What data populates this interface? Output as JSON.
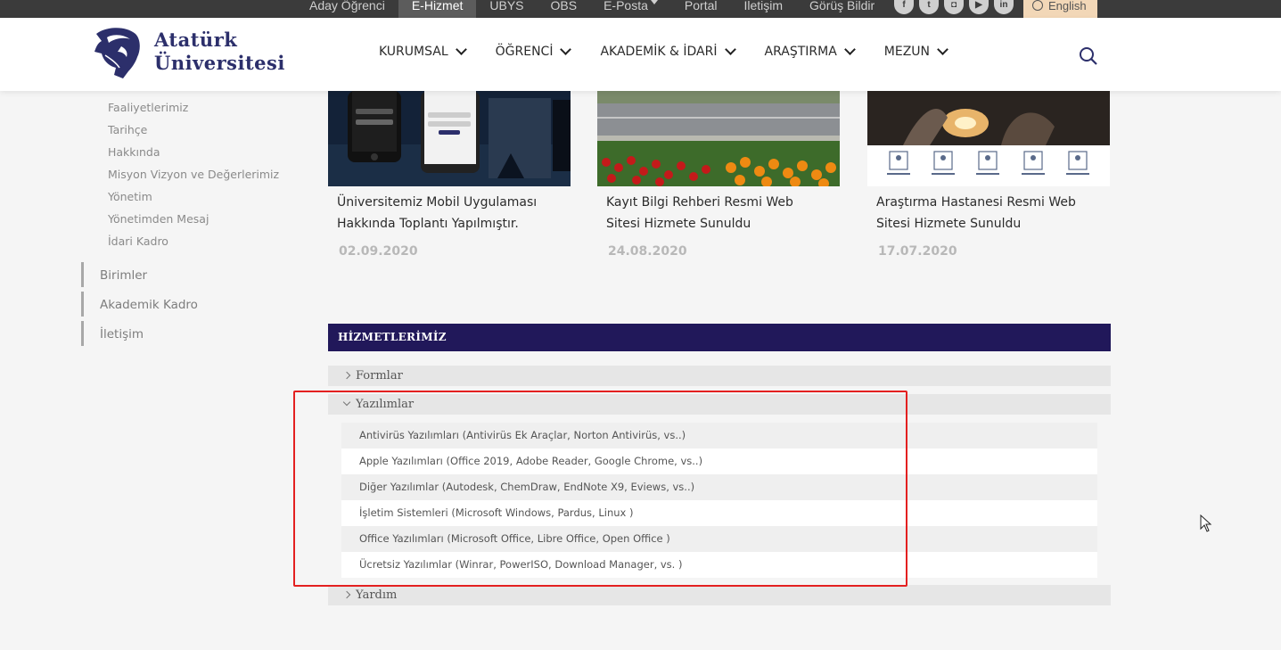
{
  "topbar": {
    "links": [
      "Aday Öğrenci",
      "E-Hizmet",
      "UBYS",
      "OBS",
      "E-Posta",
      "Portal",
      "İletişim",
      "Görüş Bildir"
    ],
    "active_index": 1,
    "social_icons": [
      "facebook-icon",
      "twitter-icon",
      "instagram-icon",
      "youtube-icon",
      "linkedin-icon"
    ],
    "language": "English"
  },
  "header": {
    "logo_line1": "Atatürk",
    "logo_line2": "Üniversitesi",
    "nav": [
      "KURUMSAL",
      "ÖĞRENCİ",
      "AKADEMİK & İDARİ",
      "ARAŞTIRMA",
      "MEZUN"
    ]
  },
  "sidebar": {
    "subitems": [
      "Faaliyetlerimiz",
      "Tarihçe",
      "Hakkında",
      "Misyon Vizyon ve Değerlerimiz",
      "Yönetim",
      "Yönetimden Mesaj",
      "İdari Kadro"
    ],
    "items": [
      "Birimler",
      "Akademik Kadro",
      "İletişim"
    ]
  },
  "news": [
    {
      "title": "Üniversitemiz Mobil Uygulaması Hakkında Toplantı Yapılmıştır.",
      "date": "02.09.2020"
    },
    {
      "title": "Kayıt Bilgi Rehberi Resmi Web Sitesi Hizmete Sunuldu",
      "date": "24.08.2020"
    },
    {
      "title": "Araştırma Hastanesi Resmi Web Sitesi Hizmete Sunuldu",
      "date": "17.07.2020"
    }
  ],
  "services": {
    "heading": "HİZMETLERİMİZ",
    "sections": [
      "Formlar",
      "Yazılımlar",
      "Yardım"
    ],
    "software": [
      "Antivirüs Yazılımları (Antivirüs Ek Araçlar, Norton Antivirüs, vs..)",
      "Apple Yazılımları (Office 2019, Adobe Reader, Google Chrome, vs..)",
      "Diğer Yazılımlar (Autodesk, ChemDraw, EndNote X9, Eviews, vs..)",
      "İşletim Sistemleri (Microsoft Windows, Pardus, Linux )",
      "Office Yazılımları (Microsoft Office, Libre Office, Open Office )",
      "Ücretsiz Yazılımlar (Winrar, PowerISO, Download Manager, vs. )"
    ]
  },
  "colors": {
    "brand_navy": "#21185a",
    "logo_text": "#2c2f6b",
    "topbar": "#3b3b3b",
    "highlight": "#e32020"
  }
}
